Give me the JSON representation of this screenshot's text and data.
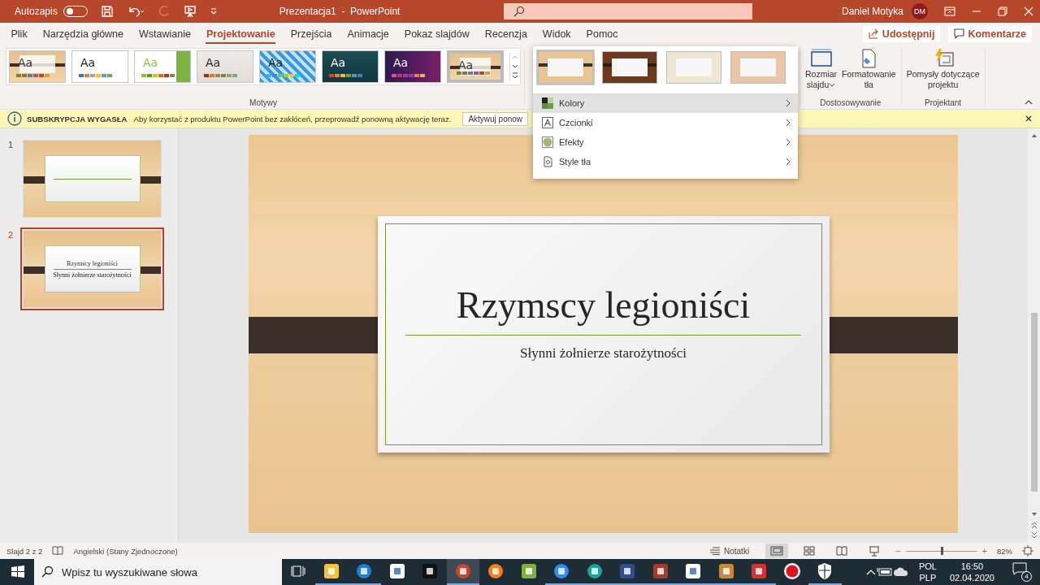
{
  "title_bar": {
    "autosave_label": "Autozapis",
    "autosave_on": false,
    "title": "Prezentacja1  -  PowerPoint",
    "user_name": "Daniel Motyka",
    "user_initials": "DM"
  },
  "ribbon_tabs": [
    {
      "label": "Plik",
      "selected": false
    },
    {
      "label": "Narzędzia główne",
      "selected": false
    },
    {
      "label": "Wstawianie",
      "selected": false
    },
    {
      "label": "Projektowanie",
      "selected": true
    },
    {
      "label": "Przejścia",
      "selected": false
    },
    {
      "label": "Animacje",
      "selected": false
    },
    {
      "label": "Pokaz slajdów",
      "selected": false
    },
    {
      "label": "Recenzja",
      "selected": false
    },
    {
      "label": "Widok",
      "selected": false
    },
    {
      "label": "Pomoc",
      "selected": false
    }
  ],
  "share_button": "Udostępnij",
  "comments_button": "Komentarze",
  "themes": {
    "group_label": "Motywy",
    "items": [
      {
        "kind": "wood",
        "sample": "Aa",
        "selected": false
      },
      {
        "kind": "office",
        "sample": "Aa",
        "selected": false
      },
      {
        "kind": "facet",
        "sample": "Aa",
        "selected": false
      },
      {
        "kind": "gray",
        "sample": "Aa",
        "selected": false
      },
      {
        "kind": "pattern",
        "sample": "Aa",
        "selected": false
      },
      {
        "kind": "teal",
        "sample": "Aa",
        "selected": false
      },
      {
        "kind": "purple",
        "sample": "Aa",
        "selected": false
      },
      {
        "kind": "wood",
        "sample": "Aa",
        "selected": true
      }
    ]
  },
  "variants": [
    {
      "kind": "light-wood",
      "selected": true
    },
    {
      "kind": "dark-wood",
      "selected": false
    },
    {
      "kind": "cream",
      "selected": false
    },
    {
      "kind": "tan",
      "selected": false
    }
  ],
  "customize": {
    "group_label": "Dostosowywanie",
    "buttons": [
      {
        "kind": "size",
        "lines": [
          "Rozmiar",
          "slajdu"
        ],
        "dropdown": true
      },
      {
        "kind": "background",
        "lines": [
          "Formatowanie",
          "tła"
        ],
        "dropdown": false
      }
    ]
  },
  "designer": {
    "group_label": "Projektant",
    "lines": [
      "Pomysły dotyczące",
      "projektu"
    ]
  },
  "info_bar": {
    "title": "SUBSKRYPCJA WYGASŁA",
    "message": "Aby korzystać z produktu PowerPoint bez zakłóceń, przeprowadź ponowną aktywację teraz.",
    "button": "Aktywuj ponow"
  },
  "menu": [
    {
      "kind": "colors",
      "label": "Kolory",
      "selected": true
    },
    {
      "kind": "fonts",
      "label": "Czcionki",
      "selected": false
    },
    {
      "kind": "effects",
      "label": "Efekty",
      "selected": false
    },
    {
      "kind": "background",
      "label": "Style tła",
      "selected": false
    }
  ],
  "slides": [
    {
      "number": "1",
      "selected": false
    },
    {
      "number": "2",
      "selected": true,
      "title": "Rzymscy legioniści",
      "subtitle": "Słynni żołnierze starożytności"
    }
  ],
  "slide": {
    "title": "Rzymscy legioniści",
    "subtitle": "Słynni żołnierze starożytności"
  },
  "status_bar": {
    "slide_info": "Slajd 2 z 2",
    "language": "Angielski (Stany Zjednoczone)",
    "notes": "Notatki",
    "views": [
      {
        "kind": "normal",
        "selected": true
      },
      {
        "kind": "sorter",
        "selected": false
      },
      {
        "kind": "reading",
        "selected": false
      },
      {
        "kind": "show",
        "selected": false
      }
    ],
    "zoom_slider": {
      "out": "−",
      "in": "+",
      "level": 0.5
    },
    "zoom": "82%"
  },
  "taskbar": {
    "search_placeholder": "Wpisz tu wyszukiwane słowa",
    "apps": [
      {
        "kind": "taskview",
        "running": false,
        "active": false
      },
      {
        "kind": "folder",
        "running": true,
        "active": false
      },
      {
        "kind": "edge",
        "running": true,
        "active": false
      },
      {
        "kind": "p",
        "running": false,
        "active": false
      },
      {
        "kind": "netflix",
        "running": false,
        "active": false
      },
      {
        "kind": "powerpoint",
        "running": true,
        "active": true
      },
      {
        "kind": "firefox",
        "running": false,
        "active": false
      },
      {
        "kind": "owl",
        "running": false,
        "active": false
      },
      {
        "kind": "zoom",
        "running": true,
        "active": false
      },
      {
        "kind": "eset",
        "running": true,
        "active": false
      },
      {
        "kind": "book",
        "running": true,
        "active": false
      },
      {
        "kind": "archive",
        "running": true,
        "active": false
      },
      {
        "kind": "photos",
        "running": true,
        "active": false
      },
      {
        "kind": "paint",
        "running": true,
        "active": false
      },
      {
        "kind": "redbox",
        "running": true,
        "active": false
      },
      {
        "kind": "record",
        "running": false,
        "active": false
      },
      {
        "kind": "shield",
        "running": true,
        "active": false
      }
    ],
    "language": "POL",
    "layout": "PLP",
    "time": "16:50",
    "date": "02.04.2020",
    "notifications": "4"
  }
}
